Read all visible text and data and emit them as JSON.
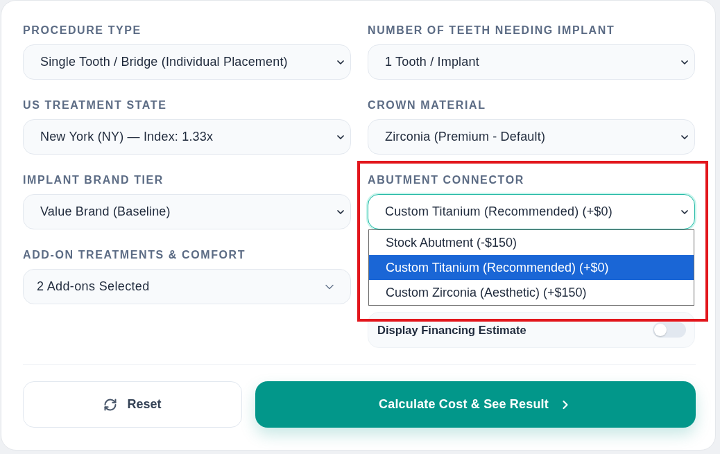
{
  "left_column": [
    {
      "kind": "select",
      "label": "PROCEDURE TYPE",
      "value": "Single Tooth / Bridge (Individual Placement)",
      "focused": false,
      "highlighted": false
    },
    {
      "kind": "select",
      "label": "US TREATMENT STATE",
      "value": "New York (NY) — Index: 1.33x",
      "focused": false,
      "highlighted": false
    },
    {
      "kind": "select",
      "label": "IMPLANT BRAND TIER",
      "value": "Value Brand (Baseline)",
      "focused": false,
      "highlighted": false
    },
    {
      "kind": "multiselect",
      "label": "ADD-ON TREATMENTS & COMFORT",
      "value": "2 Add-ons Selected",
      "focused": false,
      "highlighted": false
    }
  ],
  "right_column": [
    {
      "kind": "select",
      "label": "NUMBER OF TEETH NEEDING IMPLANT",
      "value": "1 Tooth / Implant",
      "focused": false,
      "highlighted": false
    },
    {
      "kind": "select",
      "label": "CROWN MATERIAL",
      "value": "Zirconia (Premium - Default)",
      "focused": false,
      "highlighted": false
    },
    {
      "kind": "select",
      "label": "ABUTMENT CONNECTOR",
      "value": "Custom Titanium (Recommended) (+$0)",
      "focused": true,
      "highlighted": true,
      "options": [
        {
          "label": "Stock Abutment (-$150)",
          "selected": false
        },
        {
          "label": "Custom Titanium (Recommended) (+$0)",
          "selected": true
        },
        {
          "label": "Custom Zirconia (Aesthetic) (+$150)",
          "selected": false
        }
      ]
    },
    {
      "kind": "toggle",
      "label": "Display Financing Estimate",
      "on": false,
      "highlighted": false
    }
  ],
  "buttons": [
    {
      "kind": "secondary",
      "label": "Reset"
    },
    {
      "kind": "primary",
      "label": "Calculate Cost & See Result"
    }
  ]
}
